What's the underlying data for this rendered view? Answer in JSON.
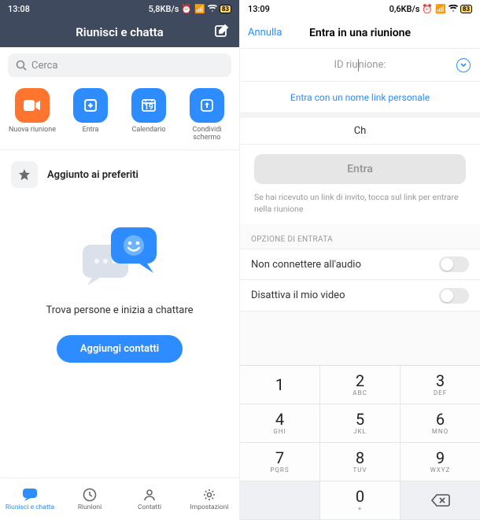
{
  "left": {
    "status": {
      "time": "13:08",
      "net": "5,8KB/s",
      "battery": "83"
    },
    "header": {
      "title": "Riunisci e chatta"
    },
    "search": {
      "placeholder": "Cerca"
    },
    "actions": [
      {
        "label": "Nuova riunione"
      },
      {
        "label": "Entra"
      },
      {
        "label": "Calendario",
        "day": "19"
      },
      {
        "label": "Condividi schermo"
      }
    ],
    "favorites": {
      "label": "Aggiunto ai preferiti"
    },
    "empty": {
      "text": "Trova persone e inizia a chattare",
      "button": "Aggiungi contatti"
    },
    "nav": [
      {
        "label": "Riunisci e chatta"
      },
      {
        "label": "Riunioni"
      },
      {
        "label": "Contatti"
      },
      {
        "label": "Impostazioni"
      }
    ]
  },
  "right": {
    "status": {
      "time": "13:09",
      "net": "0,6KB/s",
      "battery": "83"
    },
    "header": {
      "cancel": "Annulla",
      "title": "Entra in una riunione"
    },
    "id_label_pre": "ID riu",
    "id_label_post": "nione:",
    "link": "Entra con un nome link personale",
    "name": "Ch",
    "join": "Entra",
    "hint": "Se hai ricevuto un link di invito, tocca sul link per entrare nella riunione",
    "section": "OPZIONE DI ENTRATA",
    "opts": [
      {
        "label": "Non connettere all'audio"
      },
      {
        "label": "Disattiva il mio video"
      }
    ],
    "keypad": [
      [
        {
          "n": "1",
          "s": ""
        },
        {
          "n": "2",
          "s": "ABC"
        },
        {
          "n": "3",
          "s": "DEF"
        }
      ],
      [
        {
          "n": "4",
          "s": "GHI"
        },
        {
          "n": "5",
          "s": "JKL"
        },
        {
          "n": "6",
          "s": "MNO"
        }
      ],
      [
        {
          "n": "7",
          "s": "PQRS"
        },
        {
          "n": "8",
          "s": "TUV"
        },
        {
          "n": "9",
          "s": "WXYZ"
        }
      ],
      [
        {
          "n": "",
          "s": "",
          "alt": true
        },
        {
          "n": "0",
          "s": "+"
        },
        {
          "n": "⌫",
          "s": "",
          "alt": true,
          "del": true
        }
      ]
    ]
  }
}
